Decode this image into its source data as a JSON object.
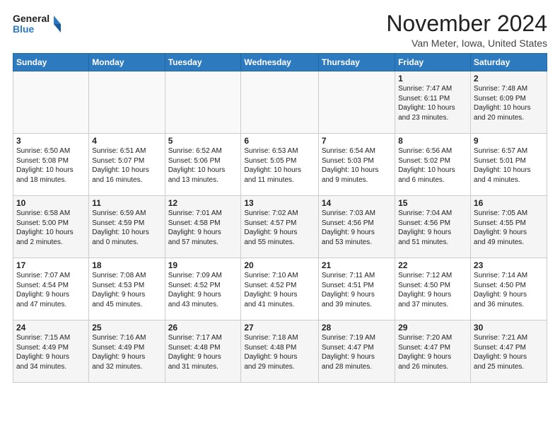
{
  "header": {
    "logo_line1": "General",
    "logo_line2": "Blue",
    "title": "November 2024",
    "location": "Van Meter, Iowa, United States"
  },
  "days_of_week": [
    "Sunday",
    "Monday",
    "Tuesday",
    "Wednesday",
    "Thursday",
    "Friday",
    "Saturday"
  ],
  "weeks": [
    [
      {
        "day": "",
        "info": ""
      },
      {
        "day": "",
        "info": ""
      },
      {
        "day": "",
        "info": ""
      },
      {
        "day": "",
        "info": ""
      },
      {
        "day": "",
        "info": ""
      },
      {
        "day": "1",
        "info": "Sunrise: 7:47 AM\nSunset: 6:11 PM\nDaylight: 10 hours\nand 23 minutes."
      },
      {
        "day": "2",
        "info": "Sunrise: 7:48 AM\nSunset: 6:09 PM\nDaylight: 10 hours\nand 20 minutes."
      }
    ],
    [
      {
        "day": "3",
        "info": "Sunrise: 6:50 AM\nSunset: 5:08 PM\nDaylight: 10 hours\nand 18 minutes."
      },
      {
        "day": "4",
        "info": "Sunrise: 6:51 AM\nSunset: 5:07 PM\nDaylight: 10 hours\nand 16 minutes."
      },
      {
        "day": "5",
        "info": "Sunrise: 6:52 AM\nSunset: 5:06 PM\nDaylight: 10 hours\nand 13 minutes."
      },
      {
        "day": "6",
        "info": "Sunrise: 6:53 AM\nSunset: 5:05 PM\nDaylight: 10 hours\nand 11 minutes."
      },
      {
        "day": "7",
        "info": "Sunrise: 6:54 AM\nSunset: 5:03 PM\nDaylight: 10 hours\nand 9 minutes."
      },
      {
        "day": "8",
        "info": "Sunrise: 6:56 AM\nSunset: 5:02 PM\nDaylight: 10 hours\nand 6 minutes."
      },
      {
        "day": "9",
        "info": "Sunrise: 6:57 AM\nSunset: 5:01 PM\nDaylight: 10 hours\nand 4 minutes."
      }
    ],
    [
      {
        "day": "10",
        "info": "Sunrise: 6:58 AM\nSunset: 5:00 PM\nDaylight: 10 hours\nand 2 minutes."
      },
      {
        "day": "11",
        "info": "Sunrise: 6:59 AM\nSunset: 4:59 PM\nDaylight: 10 hours\nand 0 minutes."
      },
      {
        "day": "12",
        "info": "Sunrise: 7:01 AM\nSunset: 4:58 PM\nDaylight: 9 hours\nand 57 minutes."
      },
      {
        "day": "13",
        "info": "Sunrise: 7:02 AM\nSunset: 4:57 PM\nDaylight: 9 hours\nand 55 minutes."
      },
      {
        "day": "14",
        "info": "Sunrise: 7:03 AM\nSunset: 4:56 PM\nDaylight: 9 hours\nand 53 minutes."
      },
      {
        "day": "15",
        "info": "Sunrise: 7:04 AM\nSunset: 4:56 PM\nDaylight: 9 hours\nand 51 minutes."
      },
      {
        "day": "16",
        "info": "Sunrise: 7:05 AM\nSunset: 4:55 PM\nDaylight: 9 hours\nand 49 minutes."
      }
    ],
    [
      {
        "day": "17",
        "info": "Sunrise: 7:07 AM\nSunset: 4:54 PM\nDaylight: 9 hours\nand 47 minutes."
      },
      {
        "day": "18",
        "info": "Sunrise: 7:08 AM\nSunset: 4:53 PM\nDaylight: 9 hours\nand 45 minutes."
      },
      {
        "day": "19",
        "info": "Sunrise: 7:09 AM\nSunset: 4:52 PM\nDaylight: 9 hours\nand 43 minutes."
      },
      {
        "day": "20",
        "info": "Sunrise: 7:10 AM\nSunset: 4:52 PM\nDaylight: 9 hours\nand 41 minutes."
      },
      {
        "day": "21",
        "info": "Sunrise: 7:11 AM\nSunset: 4:51 PM\nDaylight: 9 hours\nand 39 minutes."
      },
      {
        "day": "22",
        "info": "Sunrise: 7:12 AM\nSunset: 4:50 PM\nDaylight: 9 hours\nand 37 minutes."
      },
      {
        "day": "23",
        "info": "Sunrise: 7:14 AM\nSunset: 4:50 PM\nDaylight: 9 hours\nand 36 minutes."
      }
    ],
    [
      {
        "day": "24",
        "info": "Sunrise: 7:15 AM\nSunset: 4:49 PM\nDaylight: 9 hours\nand 34 minutes."
      },
      {
        "day": "25",
        "info": "Sunrise: 7:16 AM\nSunset: 4:49 PM\nDaylight: 9 hours\nand 32 minutes."
      },
      {
        "day": "26",
        "info": "Sunrise: 7:17 AM\nSunset: 4:48 PM\nDaylight: 9 hours\nand 31 minutes."
      },
      {
        "day": "27",
        "info": "Sunrise: 7:18 AM\nSunset: 4:48 PM\nDaylight: 9 hours\nand 29 minutes."
      },
      {
        "day": "28",
        "info": "Sunrise: 7:19 AM\nSunset: 4:47 PM\nDaylight: 9 hours\nand 28 minutes."
      },
      {
        "day": "29",
        "info": "Sunrise: 7:20 AM\nSunset: 4:47 PM\nDaylight: 9 hours\nand 26 minutes."
      },
      {
        "day": "30",
        "info": "Sunrise: 7:21 AM\nSunset: 4:47 PM\nDaylight: 9 hours\nand 25 minutes."
      }
    ]
  ]
}
